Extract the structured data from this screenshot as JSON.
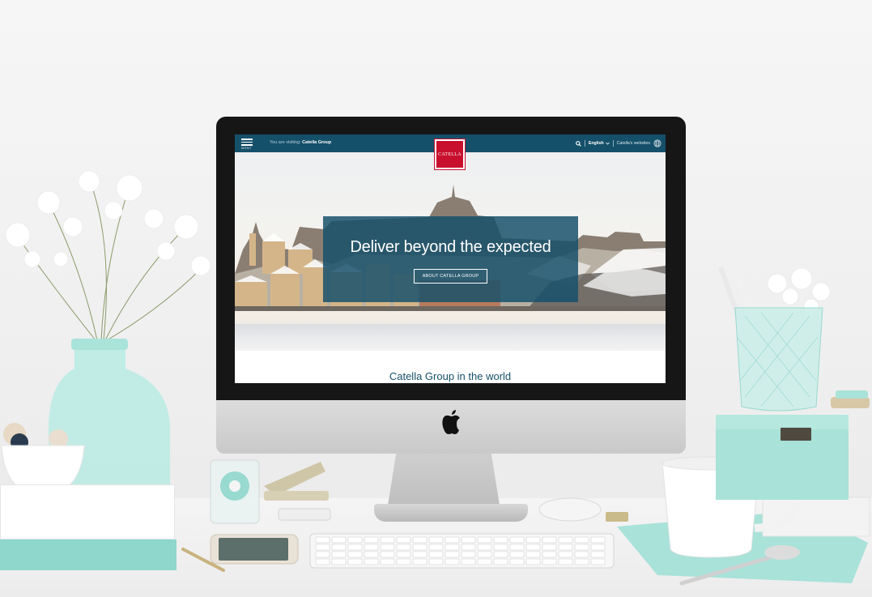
{
  "website": {
    "menu_label": "MENY",
    "visiting_label": "You are visiting:",
    "visiting_site": "Catella Group",
    "logo_text": "CATELLA",
    "language": "English",
    "websites_label": "Catella's websites",
    "hero": {
      "title": "Deliver beyond the expected",
      "button_label": "ABOUT CATELLA GROUP"
    },
    "section_title": "Catella Group in the world"
  },
  "icons": [
    "menu-icon",
    "search-icon",
    "chevron-down-icon",
    "globe-icon",
    "apple-logo-icon"
  ],
  "colors": {
    "brand_blue": "#15506a",
    "brand_red": "#c8102e",
    "accent_mint": "#8fd6cc"
  }
}
